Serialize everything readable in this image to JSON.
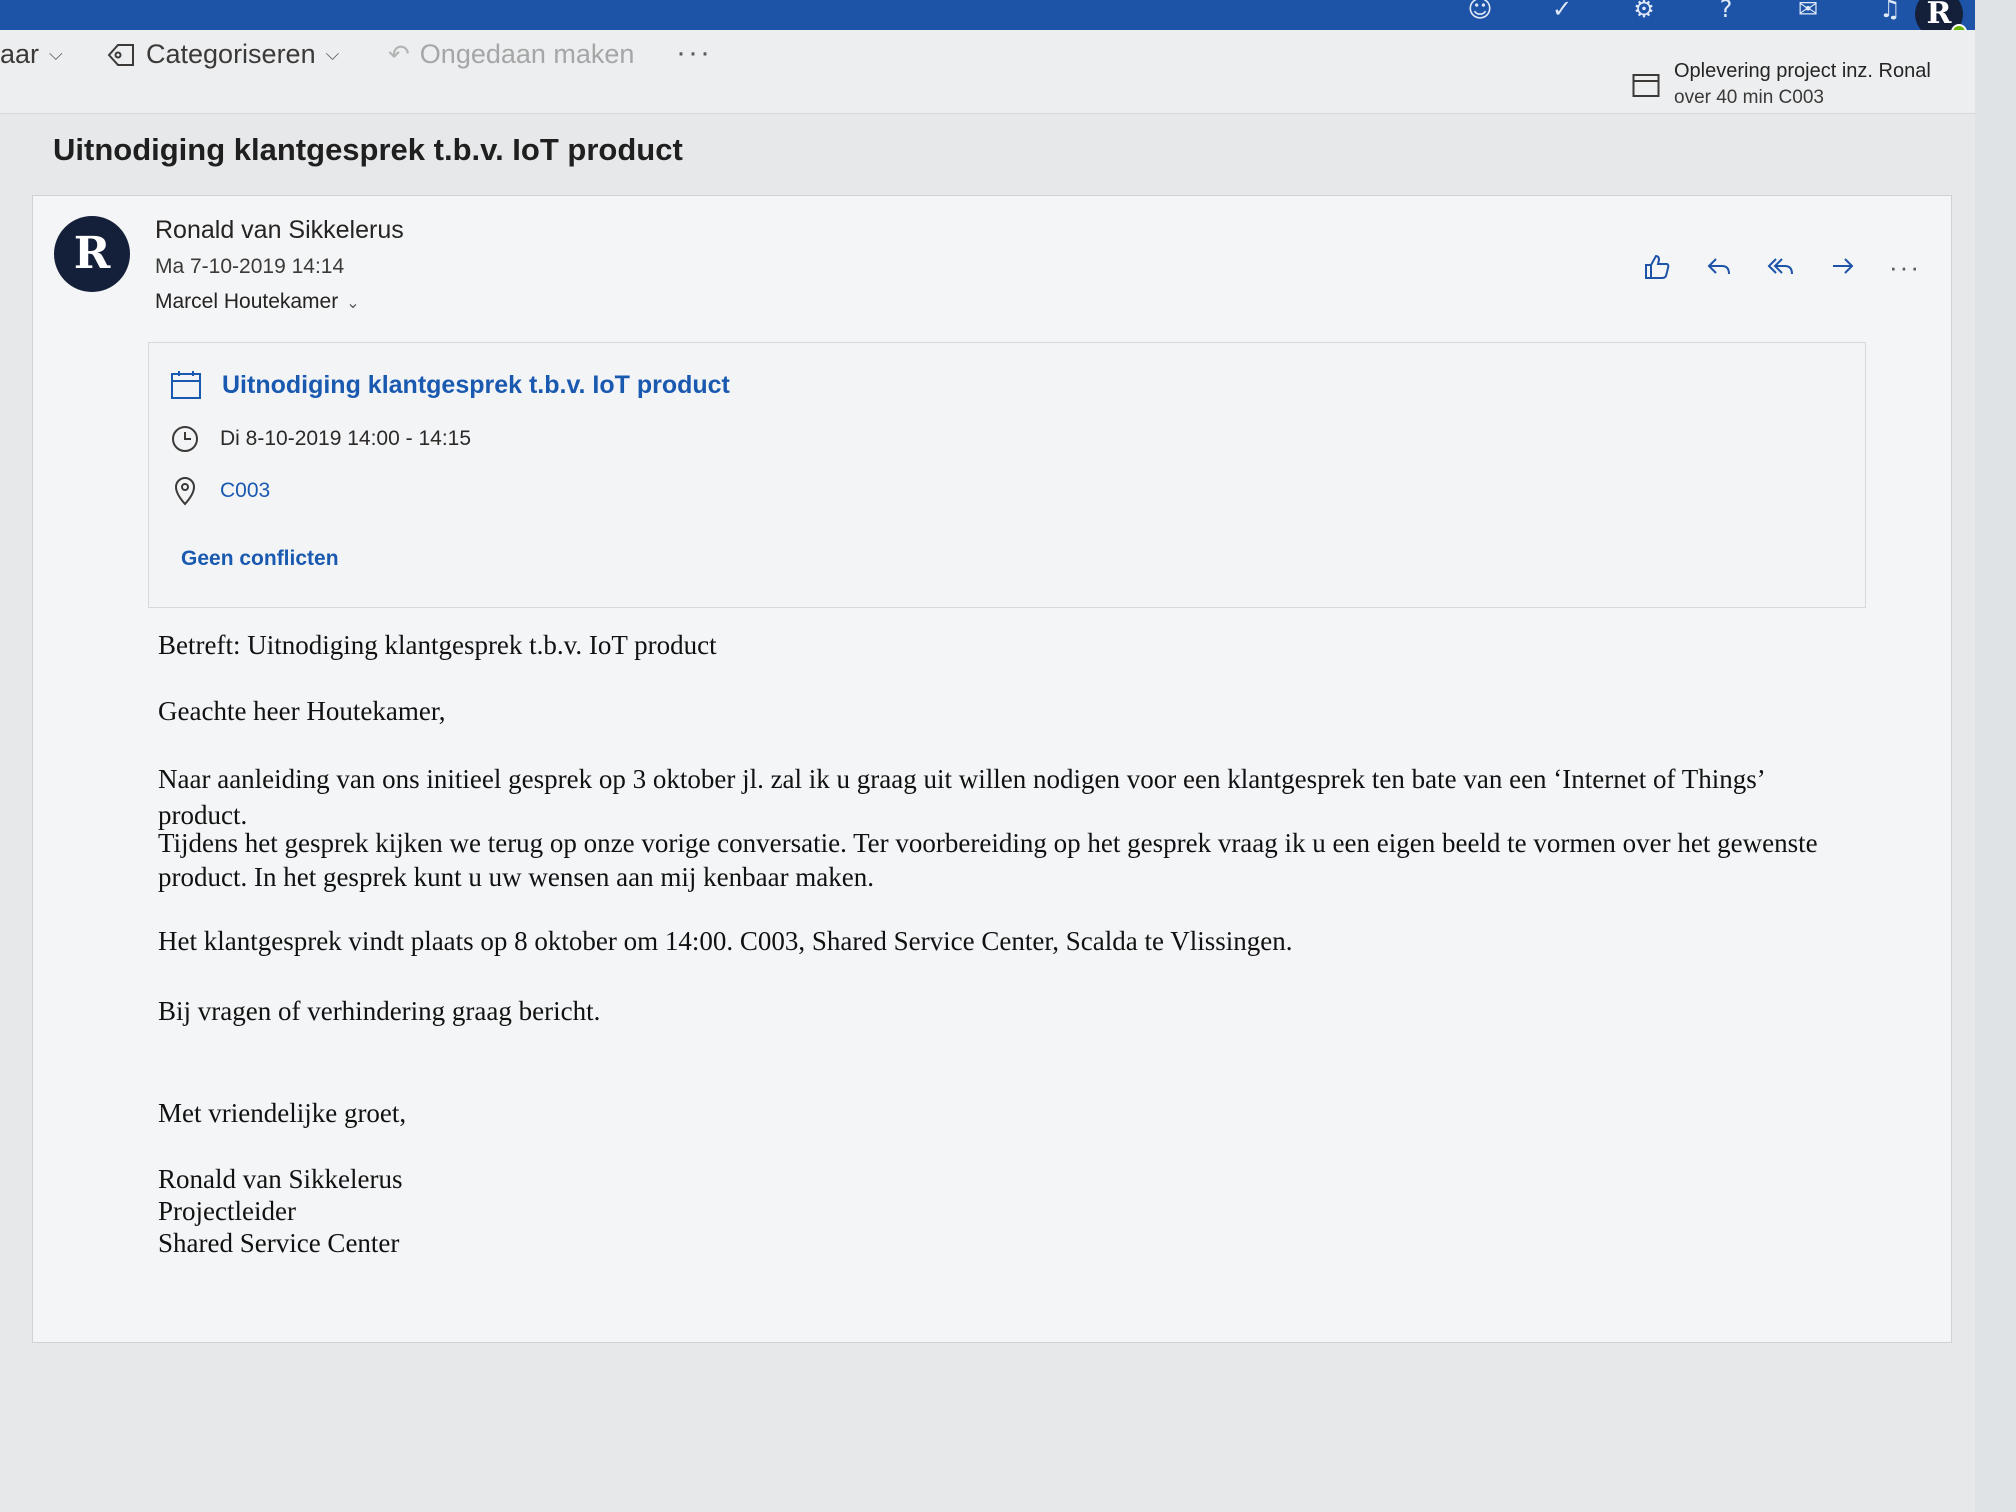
{
  "topbar": {
    "icons": [
      "skype-icon",
      "todo-icon",
      "settings-icon",
      "help-icon",
      "megaphone-icon",
      "bell-icon"
    ],
    "avatar_initial": "R"
  },
  "commandbar": {
    "partial_label": "aar",
    "categorize": "Categoriseren",
    "undo": "Ongedaan maken",
    "more": "···"
  },
  "reminder": {
    "title": "Oplevering project inz. Ronal",
    "detail": "over 40 min C003"
  },
  "message": {
    "subject": "Uitnodiging klantgesprek t.b.v. IoT product",
    "sender": "Ronald van Sikkelerus",
    "sent": "Ma 7-10-2019 14:14",
    "to": "Marcel Houtekamer",
    "avatar_initial": "R",
    "actions": [
      "like-icon",
      "reply-icon",
      "reply-all-icon",
      "forward-icon",
      "more-icon"
    ]
  },
  "invite": {
    "title": "Uitnodiging klantgesprek t.b.v. IoT product",
    "time": "Di 8-10-2019 14:00 - 14:15",
    "location": "C003",
    "conflicts": "Geen conflicten"
  },
  "body": {
    "re": "Betreft: Uitnodiging klantgesprek t.b.v. IoT product",
    "greeting": "Geachte heer Houtekamer,",
    "p1_l1": "Naar aanleiding van ons initieel gesprek op 3 oktober jl. zal ik u graag uit willen nodigen voor een klantgesprek ten bate van een ‘Internet of Things’",
    "p1_l2": "product.",
    "p1_l3": "Tijdens het gesprek kijken we terug op onze vorige conversatie. Ter voorbereiding op het gesprek vraag ik u een eigen beeld te vormen over het gewenste",
    "p1_l4": "product. In het gesprek kunt u uw wensen aan mij kenbaar maken.",
    "p2": "Het klantgesprek vindt plaats op 8 oktober om 14:00. C003, Shared Service Center, Scalda te Vlissingen.",
    "p3": "Bij vragen of verhindering graag bericht.",
    "closing": "Met vriendelijke groet,",
    "sig_name": "Ronald van Sikkelerus",
    "sig_role": "Projectleider",
    "sig_org": "Shared Service Center"
  }
}
